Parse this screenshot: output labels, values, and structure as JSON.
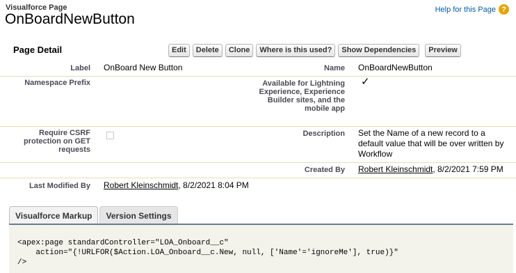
{
  "header": {
    "object_type": "Visualforce Page",
    "title": "OnBoardNewButton",
    "help_link": "Help for this Page",
    "help_icon": "question-mark-icon"
  },
  "page_detail": {
    "title": "Page Detail",
    "buttons": [
      "Edit",
      "Delete",
      "Clone",
      "Where is this used?",
      "Show Dependencies",
      "Preview"
    ]
  },
  "fields": {
    "label": {
      "label": "Label",
      "value": "OnBoard New Button"
    },
    "name": {
      "label": "Name",
      "value": "OnBoardNewButton"
    },
    "namespace": {
      "label": "Namespace Prefix",
      "value": ""
    },
    "available": {
      "label": "Available for Lightning Experience, Experience Builder sites, and the mobile app",
      "checked": true
    },
    "csrf": {
      "label": "Require CSRF protection on GET requests",
      "checked": false
    },
    "description": {
      "label": "Description",
      "value": "Set the Name of a new record to a default value that will be over written by Workflow"
    },
    "created_by": {
      "label": "Created By",
      "user": "Robert Kleinschmidt",
      "date": ", 8/2/2021 7:59 PM"
    },
    "last_modified": {
      "label": "Last Modified By",
      "user": "Robert Kleinschmidt",
      "date": ", 8/2/2021 8:04 PM"
    }
  },
  "tabs": [
    {
      "label": "Visualforce Markup",
      "active": true
    },
    {
      "label": "Version Settings",
      "active": false
    }
  ],
  "markup": "<apex:page standardController=\"LOA_Onboard__c\"\n    action=\"{!URLFOR($Action.LOA_Onboard__c.New, null, ['Name'='ignoreMe'], true)}\"\n/>",
  "colors": {
    "accent": "#e8a402",
    "link": "#015ba7",
    "border": "#e3deb8"
  }
}
